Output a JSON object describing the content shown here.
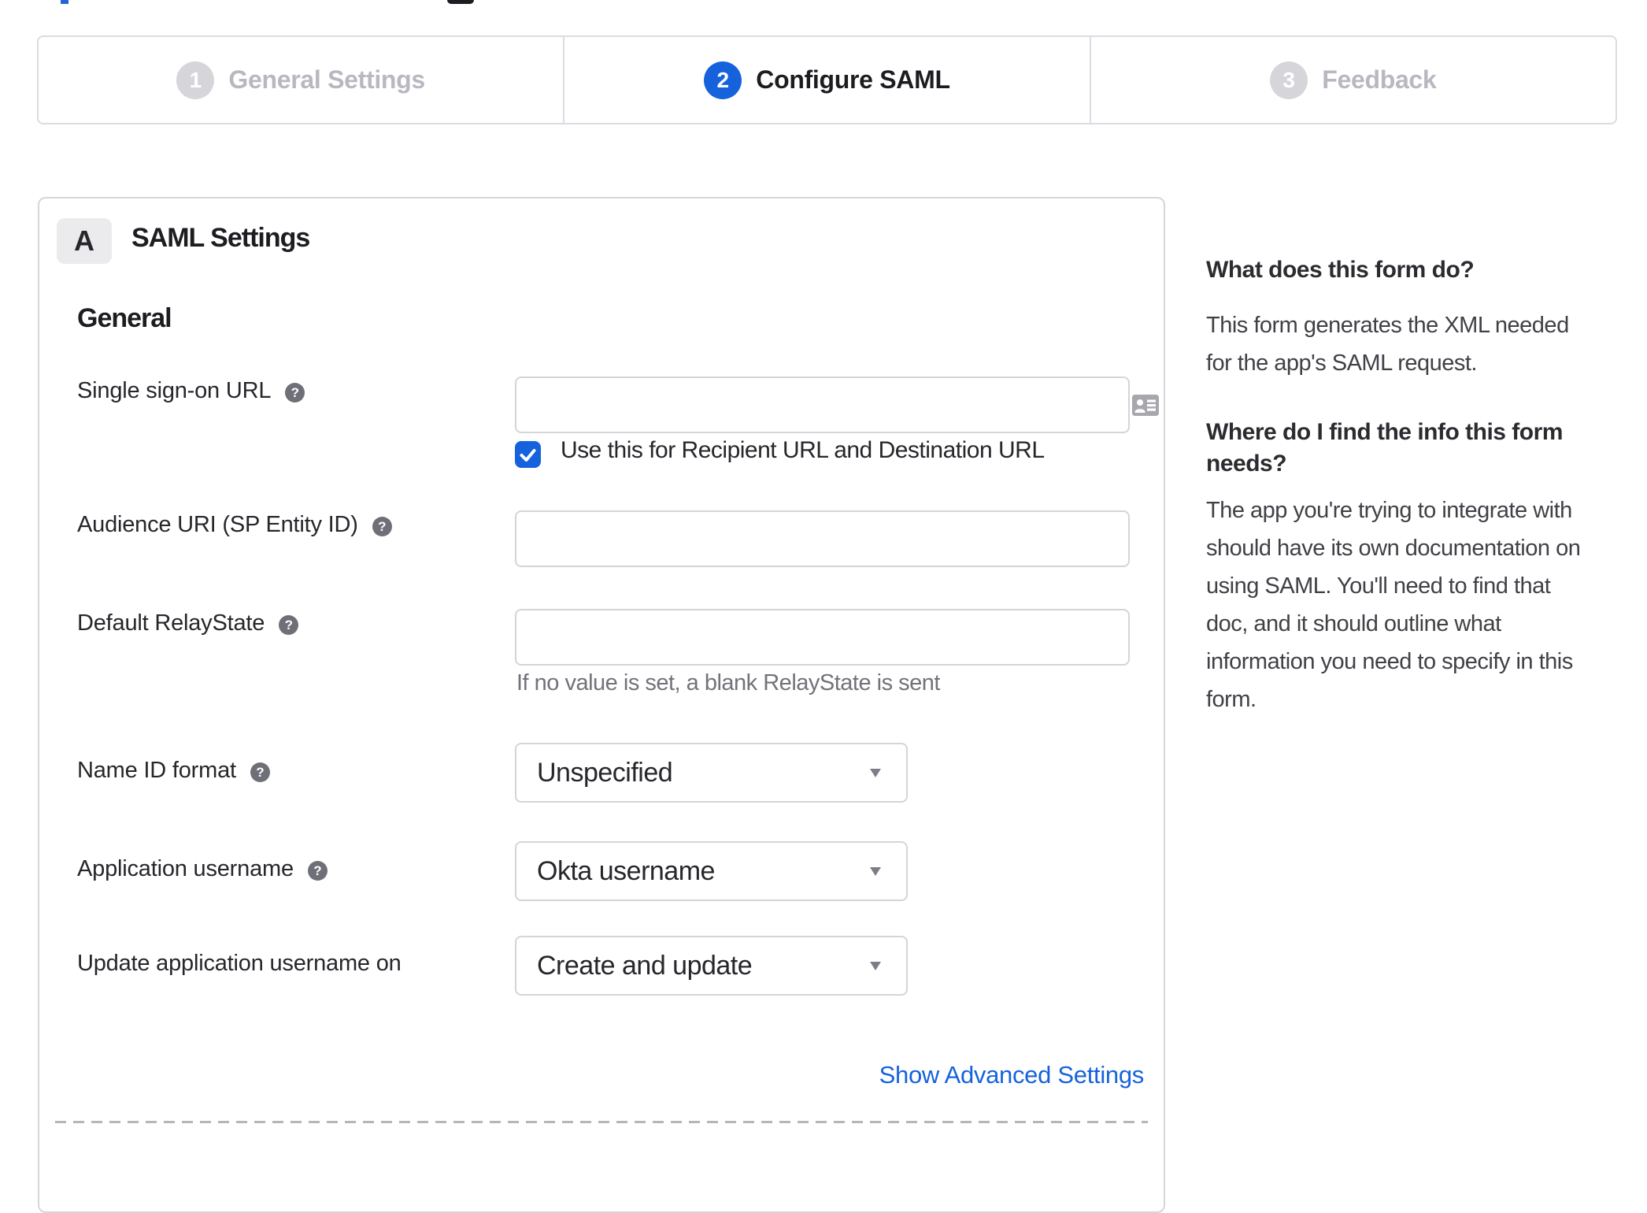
{
  "accent_color": "#1662dd",
  "stepper": {
    "steps": [
      {
        "number": "1",
        "label": "General Settings",
        "state": "inactive"
      },
      {
        "number": "2",
        "label": "Configure SAML",
        "state": "active"
      },
      {
        "number": "3",
        "label": "Feedback",
        "state": "inactive"
      }
    ]
  },
  "card": {
    "section_badge": "A",
    "section_title": "SAML Settings",
    "group_heading": "General",
    "advanced_link": "Show Advanced Settings"
  },
  "form": {
    "sso_url": {
      "label": "Single sign-on URL",
      "value": "",
      "checkbox_label": "Use this for Recipient URL and Destination URL",
      "checkbox_checked": true
    },
    "audience_uri": {
      "label": "Audience URI (SP Entity ID)",
      "value": ""
    },
    "relay_state": {
      "label": "Default RelayState",
      "value": "",
      "helper": "If no value is set, a blank RelayState is sent"
    },
    "name_id": {
      "label": "Name ID format",
      "value": "Unspecified"
    },
    "app_username": {
      "label": "Application username",
      "value": "Okta username"
    },
    "update_username": {
      "label": "Update application username on",
      "value": "Create and update"
    }
  },
  "sidebar": {
    "heading_1": "What does this form do?",
    "paragraph_1": "This form generates the XML needed\nfor the app's SAML request.",
    "heading_2": "Where do I find the info this form\nneeds?",
    "paragraph_2": "The app you're trying to integrate with\nshould have its own documentation on\nusing SAML. You'll need to find that\ndoc, and it should outline what\ninformation you need to specify in this\nform."
  }
}
